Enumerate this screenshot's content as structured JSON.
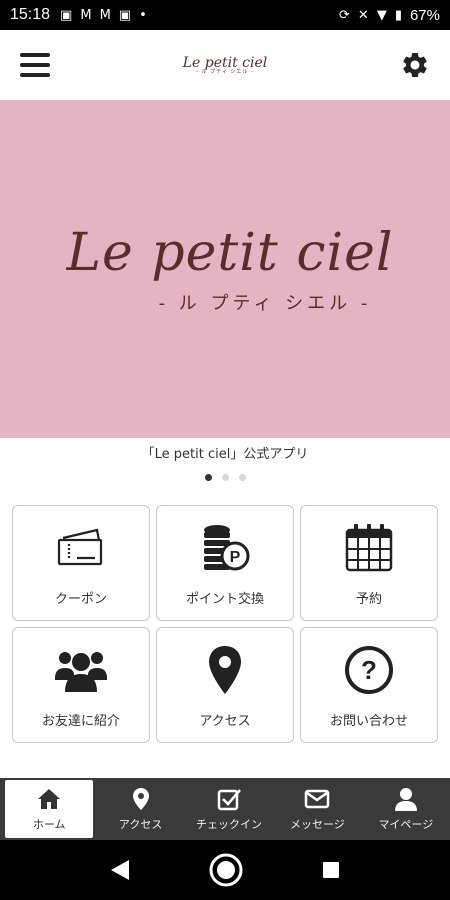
{
  "status_bar": {
    "time": "15:18",
    "battery": "67%"
  },
  "header": {
    "logo_main": "Le petit ciel",
    "logo_sub": "- ル プティ シエル -"
  },
  "hero": {
    "title": "Le petit ciel",
    "subtitle": "- ル プティ シエル -",
    "background": "#e3b4c4"
  },
  "caption": "「Le petit ciel」公式アプリ",
  "carousel": {
    "pages": 3,
    "active": 1
  },
  "menu": [
    {
      "label": "クーポン",
      "icon": "ticket-icon"
    },
    {
      "label": "ポイント交換",
      "icon": "coins-icon"
    },
    {
      "label": "予約",
      "icon": "calendar-icon"
    },
    {
      "label": "お友達に紹介",
      "icon": "friends-icon"
    },
    {
      "label": "アクセス",
      "icon": "map-pin-icon"
    },
    {
      "label": "お問い合わせ",
      "icon": "question-icon"
    }
  ],
  "tabs": [
    {
      "label": "ホーム",
      "icon": "home-icon"
    },
    {
      "label": "アクセス",
      "icon": "map-pin-icon"
    },
    {
      "label": "チェックイン",
      "icon": "checkbox-icon"
    },
    {
      "label": "メッセージ",
      "icon": "mail-icon"
    },
    {
      "label": "マイページ",
      "icon": "user-icon"
    }
  ],
  "colors": {
    "brand": "#5a2d2d",
    "tabbar": "#3a3a3a"
  }
}
